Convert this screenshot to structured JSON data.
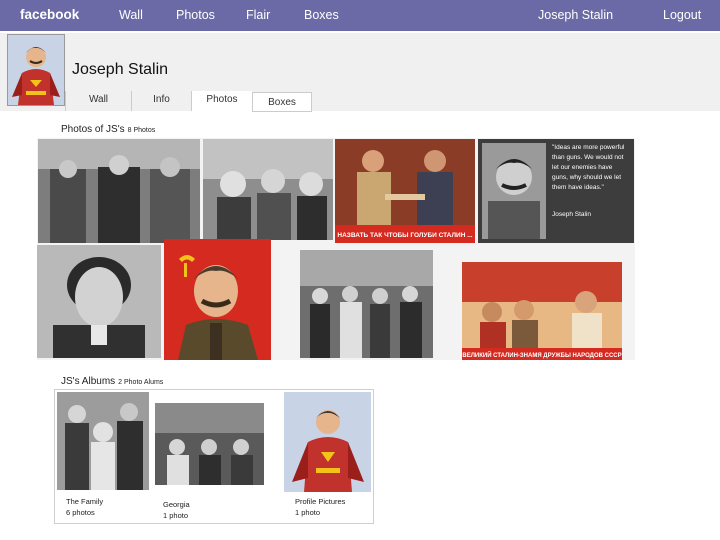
{
  "nav": {
    "logo": "facebook",
    "wall": "Wall",
    "photos": "Photos",
    "flair": "Flair",
    "boxes": "Boxes",
    "user": "Joseph Stalin",
    "logout": "Logout"
  },
  "profile": {
    "name": "Joseph Stalin",
    "tabs": [
      "Wall",
      "Info",
      "Photos",
      "Boxes"
    ]
  },
  "photos_section": {
    "title": "Photos of JS's",
    "count": "8 Photos",
    "quote": "\"Ideas are more powerful than guns. We would not let our enemies have guns, why should we let them have ideas.\"",
    "quote_author": "Joseph Stalin",
    "poster1_caption": "НАЗВАТЬ ТАК ЧТОБЫ ГОЛУБИ СТАЛИН ...",
    "poster2_caption": "ВЕЛИКИЙ СТАЛИН-ЗНАМЯ ДРУЖБЫ НАРОДОВ СССР"
  },
  "albums_section": {
    "title": "JS's Albums",
    "count": "2 Photo Alums",
    "albums": [
      {
        "name": "The Family",
        "count": "6 photos"
      },
      {
        "name": "Georgia",
        "count": "1 photo"
      },
      {
        "name": "Profile Pictures",
        "count": "1 photo"
      }
    ]
  },
  "colors": {
    "topbar": "#6b6aa6",
    "strip": "#f0f0f0",
    "poster_red": "#d42a20"
  }
}
